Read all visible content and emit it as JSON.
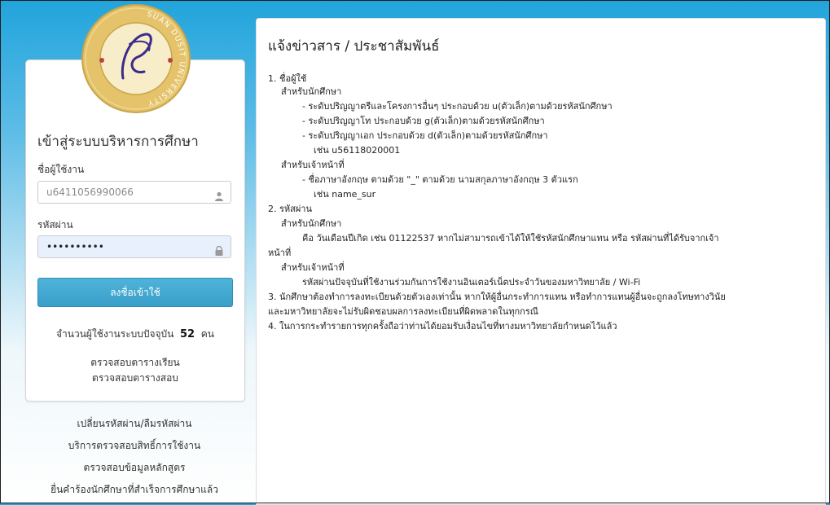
{
  "login": {
    "university_name": "SUAN DUSIT UNIVERSITY",
    "title": "เข้าสู่ระบบบริหารการศึกษา",
    "username_label": "ชื่อผู้ใช้งาน",
    "username_placeholder": "u6411056990066",
    "password_label": "รหัสผ่าน",
    "password_value": "••••••••••",
    "submit_label": "ลงชื่อเข้าใช้",
    "online_prefix": "จำนวนผู้ใช้งานระบบปัจจุบัน",
    "online_count": "52",
    "online_suffix": "คน",
    "links": [
      "ตรวจสอบตารางเรียน",
      "ตรวจสอบตารางสอบ"
    ]
  },
  "side_links": [
    "เปลี่ยนรหัสผ่าน/ลืมรหัสผ่าน",
    "บริการตรวจสอบสิทธิ์การใช้งาน",
    "ตรวจสอบข้อมูลหลักสูตร",
    "ยื่นคำร้องนักศึกษาที่สำเร็จการศึกษาแล้ว"
  ],
  "news": {
    "title": "แจ้งข่าวสาร / ประชาสัมพันธ์",
    "lines": [
      "1. ชื่อผู้ใช้",
      "สำหรับนักศึกษา",
      "- ระดับปริญญาตรีและโครงการอื่นๆ ประกอบด้วย u(ตัวเล็ก)ตามด้วยรหัสนักศึกษา",
      "- ระดับปริญญาโท ประกอบด้วย g(ตัวเล็ก)ตามด้วยรหัสนักศึกษา",
      "- ระดับปริญญาเอก ประกอบด้วย d(ตัวเล็ก)ตามด้วยรหัสนักศึกษา",
      "เช่น u56118020001",
      "สำหรับเจ้าหน้าที่",
      "- ชื่อภาษาอังกฤษ ตามด้วย \"_\" ตามด้วย นามสกุลภาษาอังกฤษ 3 ตัวแรก",
      "เช่น name_sur",
      "2. รหัสผ่าน",
      "สำหรับนักศึกษา",
      "คือ วันเดือนปีเกิด เช่น 01122537 หากไม่สามารถเข้าได้ให้ใช้รหัสนักศึกษาแทน หรือ รหัสผ่านที่ได้รับจากเจ้า",
      "หน้าที่",
      "สำหรับเจ้าหน้าที่",
      "รหัสผ่านปัจจุบันที่ใช้งานร่วมกันการใช้งานอินเตอร์เน็ตประจำวันของมหาวิทยาลัย / Wi-Fi",
      "3. นักศึกษาต้องทำการลงทะเบียนด้วยตัวเองเท่านั้น หากให้ผู้อื่นกระทำการแทน หรือทำการแทนผู้อื่นจะถูกลงโทษทางวินัย",
      "และมหาวิทยาลัยจะไม่รับผิดชอบผลการลงทะเบียนที่ผิดพลาดในทุกกรณี",
      "4. ในการกระทำรายการทุกครั้งถือว่าท่านได้ยอมรับเงื่อนไขที่ทางมหาวิทยาลัยกำหนดไว้แล้ว"
    ]
  },
  "colors": {
    "accent": "#3a9fc9",
    "background_top": "#21a4dc"
  },
  "icons": {
    "user": "user-icon",
    "lock": "lock-icon"
  }
}
